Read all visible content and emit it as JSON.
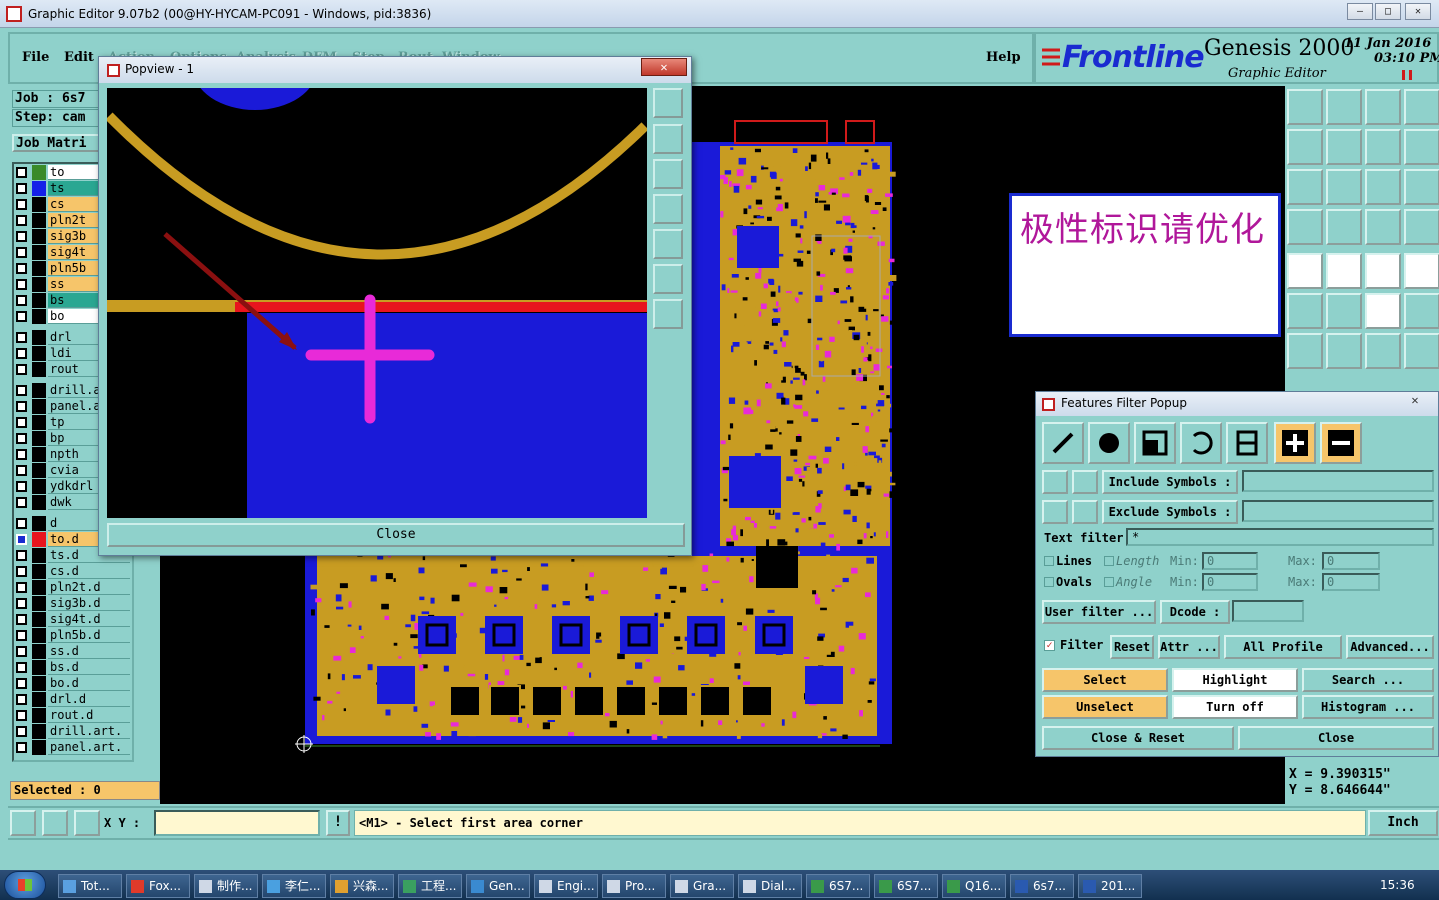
{
  "window": {
    "title": "Graphic Editor 9.07b2 (00@HY-HYCAM-PC091 - Windows, pid:3836)"
  },
  "menu": [
    "File",
    "Edit",
    "Action",
    "Options",
    "Analysis",
    "DFM",
    "Step",
    "Rout",
    "Window"
  ],
  "menu_help": "Help",
  "brand": {
    "logo": "Frontline",
    "product": "Genesis 2000",
    "sub": "Graphic Editor",
    "date": "11 Jan 2016",
    "time": "03:10 PM"
  },
  "job": {
    "job_label": "Job : 6s7",
    "step_label": "Step: cam",
    "matrix": "Job Matri"
  },
  "layers": [
    {
      "name": "to",
      "color": "#3a8a2a",
      "bg": "#ffffff"
    },
    {
      "name": "ts",
      "color": "#1520e8",
      "bg": "#2aa792"
    },
    {
      "name": "cs",
      "color": "#000000",
      "bg": "#f6c56a"
    },
    {
      "name": "pln2t",
      "color": "#000000",
      "bg": "#f6c56a"
    },
    {
      "name": "sig3b",
      "color": "#000000",
      "bg": "#f6c56a"
    },
    {
      "name": "sig4t",
      "color": "#000000",
      "bg": "#f6c56a"
    },
    {
      "name": "pln5b",
      "color": "#000000",
      "bg": "#f6c56a"
    },
    {
      "name": "ss",
      "color": "#000000",
      "bg": "#f6c56a"
    },
    {
      "name": "bs",
      "color": "#000000",
      "bg": "#2aa792"
    },
    {
      "name": "bo",
      "color": "#000000",
      "bg": "#ffffff"
    },
    {
      "name": "drl",
      "color": "#000000",
      "bg": "#8fd1cb"
    },
    {
      "name": "ldi",
      "color": "#000000",
      "bg": "#8fd1cb"
    },
    {
      "name": "rout",
      "color": "#000000",
      "bg": "#8fd1cb"
    },
    {
      "name": "drill.a",
      "color": "#000000",
      "bg": "#8fd1cb"
    },
    {
      "name": "panel.a",
      "color": "#000000",
      "bg": "#8fd1cb"
    },
    {
      "name": "tp",
      "color": "#000000",
      "bg": "#8fd1cb"
    },
    {
      "name": "bp",
      "color": "#000000",
      "bg": "#8fd1cb"
    },
    {
      "name": "npth",
      "color": "#000000",
      "bg": "#8fd1cb"
    },
    {
      "name": "cvia",
      "color": "#000000",
      "bg": "#8fd1cb"
    },
    {
      "name": "ydkdrl",
      "color": "#000000",
      "bg": "#8fd1cb"
    },
    {
      "name": "dwk",
      "color": "#000000",
      "bg": "#8fd1cb"
    },
    {
      "name": "d",
      "color": "#000000",
      "bg": "#8fd1cb"
    },
    {
      "name": "to.d",
      "color": "#e8141e",
      "bg": "#f6c56a"
    },
    {
      "name": "ts.d",
      "color": "#000000",
      "bg": "#8fd1cb"
    },
    {
      "name": "cs.d",
      "color": "#000000",
      "bg": "#8fd1cb"
    },
    {
      "name": "pln2t.d",
      "color": "#000000",
      "bg": "#8fd1cb"
    },
    {
      "name": "sig3b.d",
      "color": "#000000",
      "bg": "#8fd1cb"
    },
    {
      "name": "sig4t.d",
      "color": "#000000",
      "bg": "#8fd1cb"
    },
    {
      "name": "pln5b.d",
      "color": "#000000",
      "bg": "#8fd1cb"
    },
    {
      "name": "ss.d",
      "color": "#000000",
      "bg": "#8fd1cb"
    },
    {
      "name": "bs.d",
      "color": "#000000",
      "bg": "#8fd1cb"
    },
    {
      "name": "bo.d",
      "color": "#000000",
      "bg": "#8fd1cb"
    },
    {
      "name": "drl.d",
      "color": "#000000",
      "bg": "#8fd1cb"
    },
    {
      "name": "rout.d",
      "color": "#000000",
      "bg": "#8fd1cb"
    },
    {
      "name": "drill.art.",
      "color": "#000000",
      "bg": "#8fd1cb"
    },
    {
      "name": "panel.art.",
      "color": "#000000",
      "bg": "#8fd1cb"
    }
  ],
  "selected": "Selected : 0",
  "popview": {
    "title": "Popview - 1",
    "close": "Close"
  },
  "note": "极性标识请优化",
  "filter": {
    "title": "Features Filter Popup",
    "include": "Include Symbols :",
    "exclude": "Exclude Symbols :",
    "text_filter": "Text filter",
    "text_filter_value": "*",
    "lines": "Lines",
    "ovals": "Ovals",
    "length": "Length",
    "angle": "Angle",
    "min": "Min:",
    "max": "Max:",
    "min_value": "0",
    "max_value": "0",
    "user_filter": "User filter ...",
    "dcode": "Dcode :",
    "filter": "Filter",
    "reset": "Reset",
    "attr": "Attr ...",
    "all_profile": "All Profile",
    "advanced": "Advanced...",
    "select": "Select",
    "highlight": "Highlight",
    "search": "Search ...",
    "unselect": "Unselect",
    "turn_off": "Turn off",
    "histogram": "Histogram ...",
    "close_reset": "Close & Reset",
    "close": "Close"
  },
  "coords": {
    "x": "X = 9.390315\"",
    "y": "Y = 8.646644\""
  },
  "command": {
    "xy_label": "X Y :",
    "prompt": "<M1> - Select first area corner",
    "units": "Inch"
  },
  "taskbar": [
    {
      "label": "Tot...",
      "color": "#5aa0e0"
    },
    {
      "label": "Fox...",
      "color": "#e03a2a"
    },
    {
      "label": "制作...",
      "color": "#cfd8e6"
    },
    {
      "label": "李仁...",
      "color": "#4aa0e0"
    },
    {
      "label": "兴森...",
      "color": "#e0a030"
    },
    {
      "label": "工程...",
      "color": "#3aa060"
    },
    {
      "label": "Gen...",
      "color": "#3a8ad0"
    },
    {
      "label": "Engi...",
      "color": "#cfd8e6"
    },
    {
      "label": "Pro...",
      "color": "#cfd8e6"
    },
    {
      "label": "Gra...",
      "color": "#cfd8e6"
    },
    {
      "label": "Dial...",
      "color": "#cfd8e6"
    },
    {
      "label": "6S7...",
      "color": "#3a9a4a"
    },
    {
      "label": "6S7...",
      "color": "#3a9a4a"
    },
    {
      "label": "Q16...",
      "color": "#3a9a4a"
    },
    {
      "label": "6s7...",
      "color": "#2a5ab0"
    },
    {
      "label": "201...",
      "color": "#2a5ab0"
    }
  ],
  "clock": "15:36"
}
